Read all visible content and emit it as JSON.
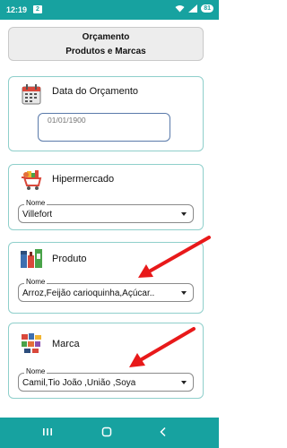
{
  "status_bar": {
    "time": "12:19",
    "badge": "2",
    "battery": "81"
  },
  "header": {
    "title": "Orçamento",
    "subtitle": "Produtos e Marcas"
  },
  "date_section": {
    "label": "Data do Orçamento",
    "placeholder": "01/01/1900",
    "icon": "calendar-icon"
  },
  "supermarket_section": {
    "label": "Hipermercado",
    "field_label": "Nome",
    "value": "Villefort",
    "icon": "shopping-cart-icon"
  },
  "product_section": {
    "label": "Produto",
    "field_label": "Nome",
    "value": "Arroz,Feijão carioquinha,Açúcar..",
    "icon": "grocery-products-icon"
  },
  "brand_section": {
    "label": "Marca",
    "field_label": "Nome",
    "value": "Camil,Tio João ,União ,Soya",
    "icon": "brands-icon"
  },
  "colors": {
    "accent": "#17a2a0",
    "card_border": "#8fcfcb",
    "arrow": "#e8191a"
  }
}
